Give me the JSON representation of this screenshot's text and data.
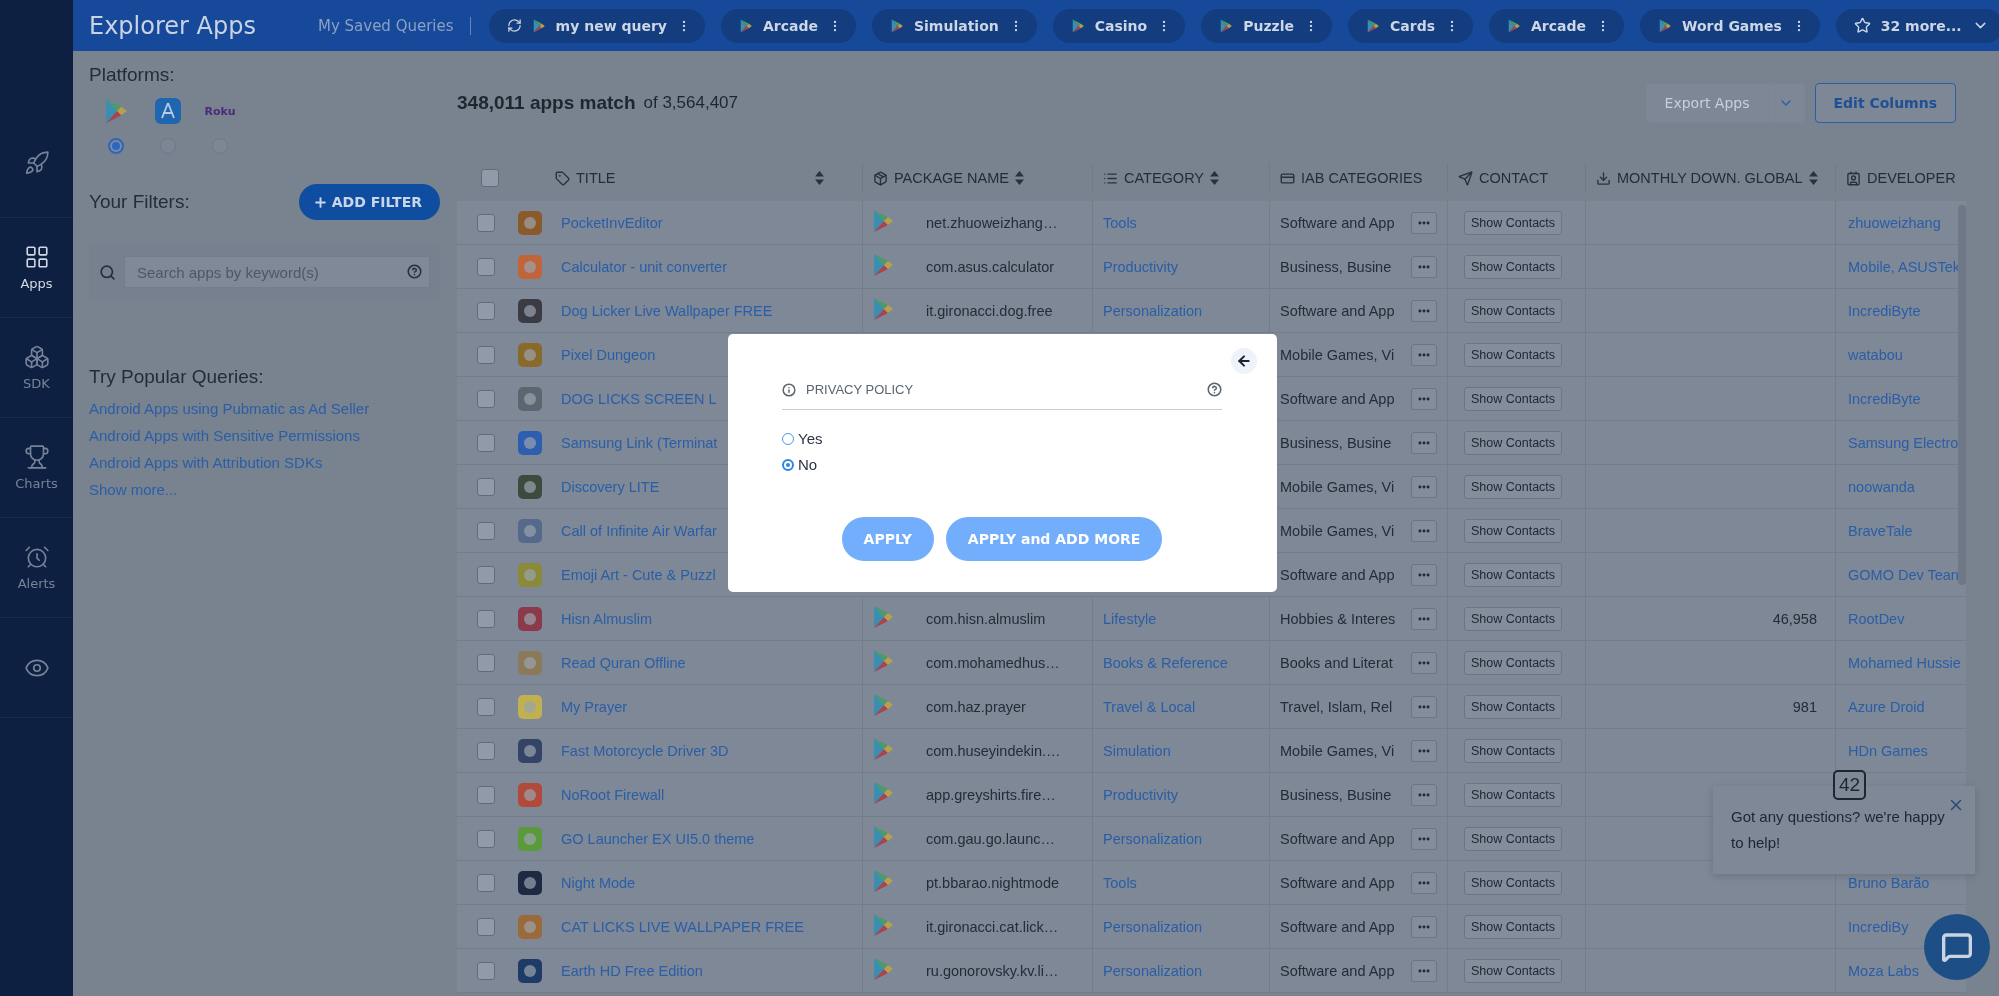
{
  "top_bar": {
    "title": "Explorer Apps",
    "saved_label": "My Saved Queries",
    "queries": [
      {
        "label": "my new query",
        "kind": "synced"
      },
      {
        "label": "Arcade",
        "kind": "plain"
      },
      {
        "label": "Simulation",
        "kind": "plain"
      },
      {
        "label": "Casino",
        "kind": "plain"
      },
      {
        "label": "Puzzle",
        "kind": "plain"
      },
      {
        "label": "Cards",
        "kind": "plain"
      },
      {
        "label": "Arcade",
        "kind": "plain"
      },
      {
        "label": "Word Games",
        "kind": "plain"
      }
    ],
    "more": "32 more..."
  },
  "nav": [
    {
      "kind": "rocket",
      "selected": false
    },
    {
      "kind": "apps",
      "label": "Apps",
      "selected": true
    },
    {
      "kind": "sdk",
      "label": "SDK",
      "selected": false
    },
    {
      "kind": "charts",
      "label": "Charts",
      "selected": false
    },
    {
      "kind": "alerts",
      "label": "Alerts",
      "selected": false
    },
    {
      "kind": "eye",
      "selected": false
    }
  ],
  "sidebar": {
    "platforms_label": "Platforms:",
    "platforms": [
      {
        "kind": "google_play",
        "selected": true
      },
      {
        "kind": "app_store",
        "selected": false
      },
      {
        "kind": "roku",
        "label": "Roku",
        "selected": false
      }
    ],
    "filters_label": "Your Filters:",
    "add_filter": "ADD FILTER",
    "search": {
      "placeholder": "Search apps by keyword(s)"
    },
    "popular_label": "Try Popular Queries:",
    "popular": [
      "Android Apps using Pubmatic as Ad Seller",
      "Android Apps with Sensitive Permissions",
      "Android Apps with Attribution SDKs"
    ],
    "show_more": "Show more..."
  },
  "results": {
    "count": "348,011 apps match",
    "total": "of 3,564,407",
    "export": {
      "label": "Export Apps",
      "disabled": true
    },
    "edit_columns": "Edit Columns"
  },
  "table": {
    "select_all": {
      "checked": false
    },
    "columns": [
      {
        "label": "TITLE",
        "kind": "tag",
        "sortable": true
      },
      {
        "label": "PACKAGE NAME",
        "kind": "package",
        "sortable": true
      },
      {
        "label": "CATEGORY",
        "kind": "list",
        "sortable": true
      },
      {
        "label": "IAB CATEGORIES",
        "kind": "card",
        "sortable": false
      },
      {
        "label": "CONTACT",
        "kind": "send",
        "sortable": false
      },
      {
        "label": "MONTHLY DOWN. GLOBAL",
        "kind": "download",
        "sortable": true
      },
      {
        "label": "DEVELOPER",
        "kind": "badge",
        "sortable": false
      }
    ],
    "rows": [
      {
        "checked": false,
        "title": "PocketInvEditor",
        "store": true,
        "package": "net.zhuoweizhang…",
        "category": "Tools",
        "iab": "Software and App",
        "contact": "Show Contacts",
        "developer": "zhuoweizhang"
      },
      {
        "checked": false,
        "title": "Calculator - unit converter",
        "store": true,
        "package": "com.asus.calculator",
        "category": "Productivity",
        "iab": "Business, Busine",
        "contact": "Show Contacts",
        "developer": "Mobile, ASUSTek"
      },
      {
        "checked": false,
        "title": "Dog Licker Live Wallpaper FREE",
        "store": true,
        "package": "it.gironacci.dog.free",
        "category": "Personalization",
        "iab": "Software and App",
        "contact": "Show Contacts",
        "developer": "IncrediByte"
      },
      {
        "checked": false,
        "title": "Pixel Dungeon",
        "iab": "Mobile Games, Vi",
        "contact": "Show Contacts",
        "developer": "watabou"
      },
      {
        "checked": false,
        "title": "DOG LICKS SCREEN L",
        "iab": "Software and App",
        "contact": "Show Contacts",
        "developer": "IncrediByte"
      },
      {
        "checked": false,
        "title": "Samsung Link (Terminat",
        "iab": "Business, Busine",
        "contact": "Show Contacts",
        "developer": "Samsung Electro"
      },
      {
        "checked": false,
        "title": "Discovery LITE",
        "iab": "Mobile Games, Vi",
        "contact": "Show Contacts",
        "developer": "noowanda"
      },
      {
        "checked": false,
        "title": "Call of Infinite Air Warfar",
        "iab": "Mobile Games, Vi",
        "contact": "Show Contacts",
        "developer": "BraveTale"
      },
      {
        "checked": false,
        "title": "Emoji Art - Cute & Puzzl",
        "iab": "Software and App",
        "contact": "Show Contacts",
        "developer": "GOMO Dev Tean"
      },
      {
        "checked": false,
        "title": "Hisn Almuslim",
        "store": true,
        "package": "com.hisn.almuslim",
        "category": "Lifestyle",
        "iab": "Hobbies & Interes",
        "contact": "Show Contacts",
        "downloads": "46,958",
        "developer": "RootDev"
      },
      {
        "checked": false,
        "title": "Read Quran Offline",
        "store": true,
        "package": "com.mohamedhus…",
        "category": "Books & Reference",
        "iab": "Books and Literat",
        "contact": "Show Contacts",
        "developer": "Mohamed Hussie"
      },
      {
        "checked": false,
        "title": "My Prayer",
        "store": true,
        "package": "com.haz.prayer",
        "category": "Travel & Local",
        "iab": "Travel, Islam, Rel",
        "contact": "Show Contacts",
        "downloads": "981",
        "developer": "Azure Droid"
      },
      {
        "checked": false,
        "title": "Fast Motorcycle Driver 3D",
        "store": true,
        "package": "com.huseyindekin.…",
        "category": "Simulation",
        "iab": "Mobile Games, Vi",
        "contact": "Show Contacts",
        "developer": "HDn Games"
      },
      {
        "checked": false,
        "title": "NoRoot Firewall",
        "store": true,
        "package": "app.greyshirts.fire…",
        "category": "Productivity",
        "iab": "Business, Busine",
        "contact": "Show Contacts"
      },
      {
        "checked": false,
        "title": "GO Launcher EX UI5.0 theme",
        "store": true,
        "package": "com.gau.go.launc…",
        "category": "Personalization",
        "iab": "Software and App",
        "contact": "Show Contacts"
      },
      {
        "checked": false,
        "title": "Night Mode",
        "store": true,
        "package": "pt.bbarao.nightmode",
        "category": "Tools",
        "iab": "Software and App",
        "contact": "Show Contacts",
        "developer": "Bruno Barão"
      },
      {
        "checked": false,
        "title": "CAT LICKS LIVE WALLPAPER FREE",
        "store": true,
        "package": "it.gironacci.cat.lick…",
        "category": "Personalization",
        "iab": "Software and App",
        "contact": "Show Contacts",
        "developer": "IncrediBy"
      },
      {
        "checked": false,
        "title": "Earth HD Free Edition",
        "store": true,
        "package": "ru.gonorovsky.kv.li…",
        "category": "Personalization",
        "iab": "Software and App",
        "contact": "Show Contacts",
        "developer": "Moza Labs"
      }
    ]
  },
  "modal": {
    "field": "PRIVACY POLICY",
    "options": [
      {
        "label": "Yes",
        "selected": false
      },
      {
        "label": "No",
        "selected": true
      }
    ],
    "buttons": [
      "APPLY",
      "APPLY and ADD MORE"
    ]
  },
  "chat": {
    "badge": "42",
    "message": "Got any questions? we're happy to help!"
  }
}
